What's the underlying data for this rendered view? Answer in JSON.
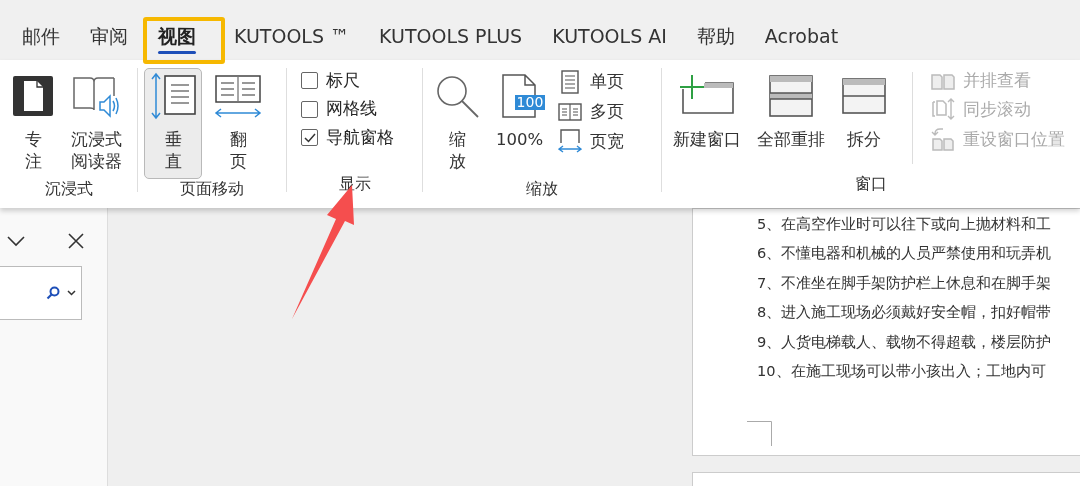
{
  "tabs": [
    {
      "label": "邮件",
      "selected": false
    },
    {
      "label": "审阅",
      "selected": false
    },
    {
      "label": "视图",
      "selected": true
    },
    {
      "label": "KUTOOLS ™",
      "selected": false
    },
    {
      "label": "KUTOOLS PLUS",
      "selected": false
    },
    {
      "label": "KUTOOLS AI",
      "selected": false
    },
    {
      "label": "帮助",
      "selected": false
    },
    {
      "label": "Acrobat",
      "selected": false
    }
  ],
  "ribbon": {
    "groups": [
      {
        "label": "沉浸式",
        "items": [
          {
            "kind": "large",
            "lines": [
              "专",
              "注"
            ],
            "disabled": false
          },
          {
            "kind": "large",
            "lines": [
              "沉浸式",
              "阅读器"
            ],
            "disabled": false
          }
        ]
      },
      {
        "label": "页面移动",
        "items": [
          {
            "kind": "large",
            "lines": [
              "垂",
              "直"
            ],
            "selected": true,
            "disabled": false
          },
          {
            "kind": "large",
            "lines": [
              "翻",
              "页"
            ],
            "selected": false,
            "disabled": false
          }
        ]
      },
      {
        "label": "显示",
        "items": [
          {
            "kind": "checkbox",
            "label": "标尺",
            "checked": false
          },
          {
            "kind": "checkbox",
            "label": "网格线",
            "checked": false
          },
          {
            "kind": "checkbox",
            "label": "导航窗格",
            "checked": true
          }
        ]
      },
      {
        "label": "缩放",
        "items": [
          {
            "kind": "large",
            "lines": [
              "缩",
              "放"
            ],
            "disabled": false
          },
          {
            "kind": "large",
            "lines": [
              "100%"
            ],
            "badge": "100",
            "disabled": false
          },
          {
            "kind": "small",
            "label": "单页",
            "disabled": false
          },
          {
            "kind": "small",
            "label": "多页",
            "disabled": false
          },
          {
            "kind": "small",
            "label": "页宽",
            "disabled": false
          }
        ]
      },
      {
        "label": "窗口",
        "items": [
          {
            "kind": "large",
            "lines": [
              "新建窗口"
            ],
            "disabled": false
          },
          {
            "kind": "large",
            "lines": [
              "全部重排"
            ],
            "disabled": false
          },
          {
            "kind": "large",
            "lines": [
              "拆分"
            ],
            "disabled": false
          },
          {
            "kind": "small",
            "label": "并排查看",
            "disabled": true
          },
          {
            "kind": "small",
            "label": "同步滚动",
            "disabled": true
          },
          {
            "kind": "small",
            "label": "重设窗口位置",
            "disabled": true
          }
        ]
      }
    ]
  },
  "document": {
    "lines": [
      "5、在高空作业时可以往下或向上抛材料和工",
      "6、不懂电器和机械的人员严禁使用和玩弄机",
      "7、不准坐在脚手架防护栏上休息和在脚手架",
      "8、进入施工现场必须戴好安全帽，扣好帽带",
      "9、人货电梯载人、载物不得超载，楼层防护",
      "10、在施工现场可以带小孩出入；工地内可"
    ]
  }
}
